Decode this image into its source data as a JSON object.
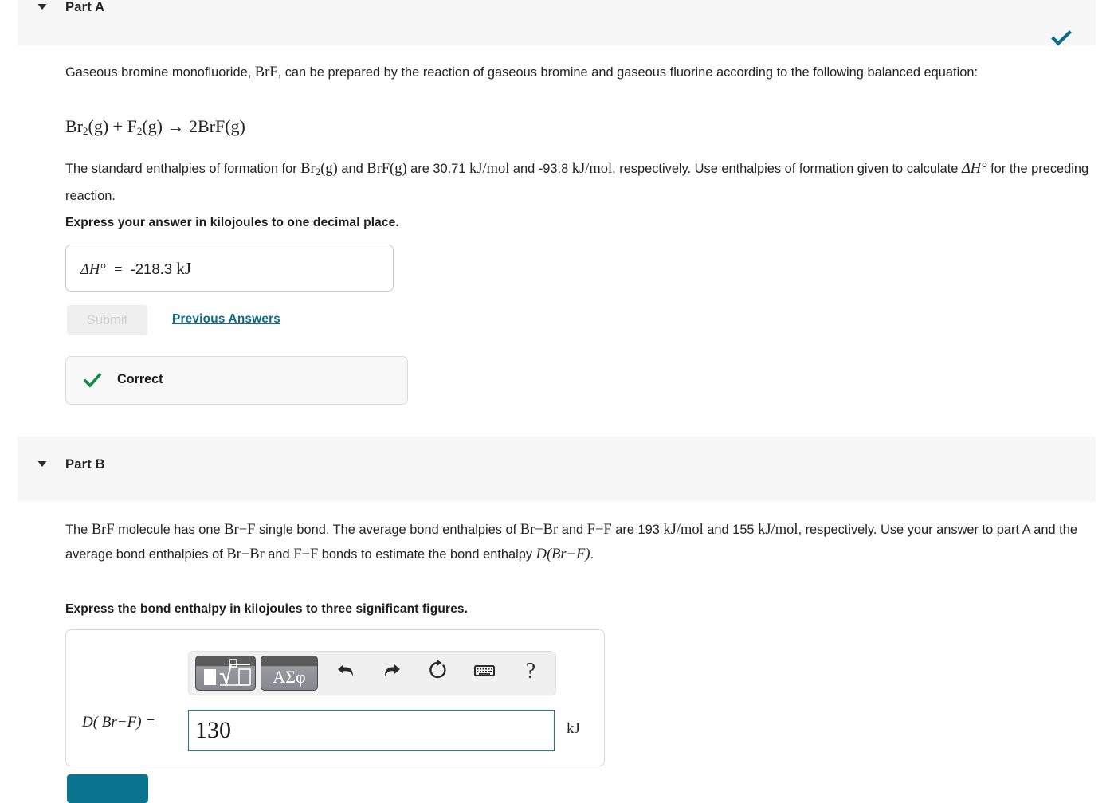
{
  "part_a": {
    "toggle_icon": "triangle-down",
    "title": "Part A",
    "status_icon": "check-icon",
    "paragraph_1_pre": "Gaseous bromine monofluoride, ",
    "paragraph_1_formula": "BrF",
    "paragraph_1_post": ", can be prepared by the reaction of gaseous bromine and gaseous fluorine according to the following balanced equation:",
    "equation": "Br₂ (g) + F₂ (g) → 2BrF(g)",
    "equation_parts": {
      "reactant_1": "Br",
      "reactant_1_sub": "2",
      "reactant_1_state": "(g)",
      "plus": "+",
      "reactant_2": "F",
      "reactant_2_sub": "2",
      "reactant_2_state": "(g)",
      "arrow": "→",
      "product_coeff": "2",
      "product": "BrF",
      "product_state": "(g)"
    },
    "paragraph_2_a": "The standard enthalpies of formation for ",
    "paragraph_2_sp1": "Br",
    "paragraph_2_sp1_sub": "2",
    "paragraph_2_sp1_state": "(g)",
    "paragraph_2_b": " and ",
    "paragraph_2_sp2": "BrF(g)",
    "paragraph_2_c": " are 30.71 ",
    "paragraph_2_unit1": "kJ/mol",
    "paragraph_2_d": " and -93.8 ",
    "paragraph_2_unit2": "kJ/mol",
    "paragraph_2_e": ", respectively. Use enthalpies of formation given to calculate ",
    "paragraph_2_symbol": "ΔH°",
    "paragraph_2_f": " for the preceding reaction.",
    "instruction": "Express your answer in kilojoules to one decimal place.",
    "answer_symbol": "ΔH°  =  ",
    "answer_value": "-218.3",
    "answer_unit": "kJ",
    "submit_label": "Submit",
    "previous_answers_label": "Previous Answers",
    "feedback_icon": "check-icon",
    "feedback_label": "Correct"
  },
  "part_b": {
    "toggle_icon": "triangle-down",
    "title": "Part B",
    "paragraph_a": "The ",
    "paragraph_brf": "BrF",
    "paragraph_b": " molecule has one ",
    "paragraph_brf_bond": "Br−F",
    "paragraph_c": " single bond. The average bond enthalpies of ",
    "paragraph_brbr": "Br−Br",
    "paragraph_d": " and ",
    "paragraph_ff": "F−F",
    "paragraph_e": " are 193 ",
    "paragraph_unit1": "kJ/mol",
    "paragraph_f": " and 155 ",
    "paragraph_unit2": "kJ/mol",
    "paragraph_g": ", respectively. Use your answer to part A and the average bond enthalpies of ",
    "paragraph_brbr2": "Br−Br",
    "paragraph_h": " and ",
    "paragraph_ff2": "F−F",
    "paragraph_i": " bonds to estimate the bond enthalpy ",
    "paragraph_symbol": "D(Br−F)",
    "paragraph_j": ".",
    "instruction": "Express the bond enthalpy in kilojoules to three significant figures.",
    "toolbar": {
      "template_button_icon": "math-template-icon",
      "greek_button_label": "ΑΣφ",
      "undo_icon": "undo-arrow-icon",
      "redo_icon": "redo-arrow-icon",
      "reset_icon": "reset-circular-arrow-icon",
      "keyboard_icon": "keyboard-icon",
      "help_icon": "question-mark-icon",
      "help_label": "?"
    },
    "answer_prefix": "D( Br−F) =",
    "answer_value": "130",
    "answer_placeholder": "",
    "answer_unit": "kJ",
    "submit_label": ""
  },
  "colors": {
    "band_background": "#f7f7f8",
    "teal_accent": "#0a6c88",
    "teal_button": "#0a7390",
    "correct_green": "#158a42",
    "input_focus_border": "#1a7b96",
    "text": "#232323"
  }
}
